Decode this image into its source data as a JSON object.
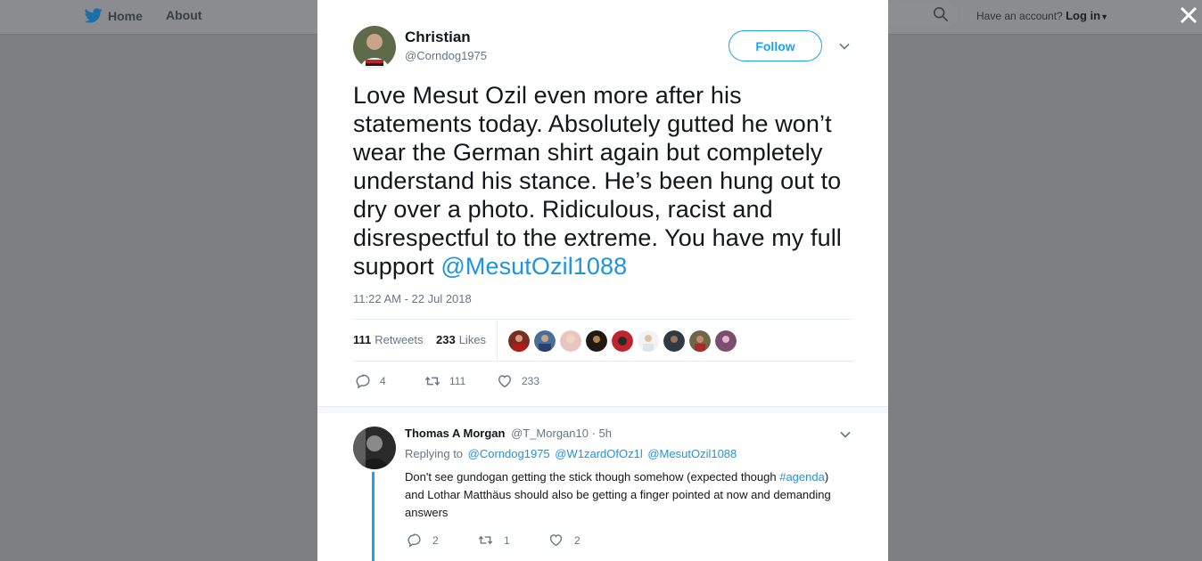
{
  "nav": {
    "home_label": "Home",
    "about_label": "About",
    "account_prompt": "Have an account?",
    "login_label": "Log in"
  },
  "tweet": {
    "author_name": "Christian",
    "author_handle": "@Corndog1975",
    "follow_label": "Follow",
    "text_main": "Love Mesut Ozil even more after his statements today. Absolutely gutted he won’t wear the German shirt again but completely understand his stance. He’s been hung out to dry over a photo. Ridiculous, racist and disrespectful to the extreme. You have my full support ",
    "text_mention": "@MesutOzil1088",
    "timestamp": "11:22 AM - 22 Jul 2018",
    "retweets_count": "111",
    "retweets_label": "Retweets",
    "likes_count": "233",
    "likes_label": "Likes",
    "reply_count": "4",
    "retweet_count": "111",
    "like_count": "233"
  },
  "reply": {
    "author_name": "Thomas A Morgan",
    "author_handle": "@T_Morgan10",
    "time": "· 5h",
    "replying_to_label": "Replying to",
    "replying_to": [
      "@Corndog1975",
      "@W1zardOfOz1l",
      "@MesutOzil1088"
    ],
    "text_part1": "Don't see gundogan getting the stick though somehow (expected though ",
    "text_hashtag": "#agenda",
    "text_part2": ") and Lothar Matthäus should also be getting a finger pointed at now and demanding answers",
    "reply_count": "2",
    "retweet_count": "1",
    "like_count": "2"
  },
  "colors": {
    "accent": "#1da1f2",
    "link": "#1b95e0",
    "muted": "#657786",
    "overlay": "#7d7f82"
  },
  "icons": [
    "twitter-bird-icon",
    "search-icon",
    "close-icon",
    "chevron-down-icon",
    "reply-icon",
    "retweet-icon",
    "heart-icon"
  ]
}
